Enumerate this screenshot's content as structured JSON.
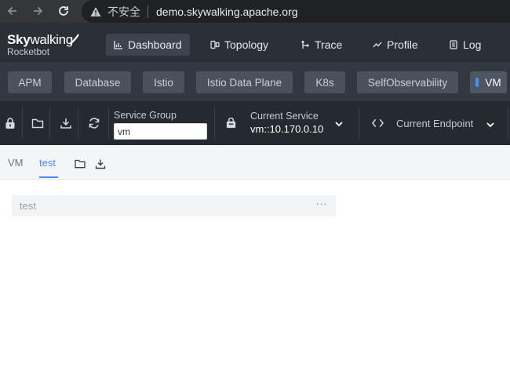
{
  "browser": {
    "insecure_label": "不安全",
    "url": "demo.skywalking.apache.org"
  },
  "logo": {
    "line1_a": "Sky",
    "line1_b": "walking",
    "line2": "Rocketbot"
  },
  "main_nav": [
    {
      "label": "Dashboard",
      "icon": "dashboard-icon",
      "active": true
    },
    {
      "label": "Topology",
      "icon": "topology-icon",
      "active": false
    },
    {
      "label": "Trace",
      "icon": "trace-icon",
      "active": false
    },
    {
      "label": "Profile",
      "icon": "profile-icon",
      "active": false
    },
    {
      "label": "Log",
      "icon": "log-icon",
      "active": false
    }
  ],
  "template_tabs": [
    {
      "label": "APM",
      "active": false
    },
    {
      "label": "Database",
      "active": false
    },
    {
      "label": "Istio",
      "active": false
    },
    {
      "label": "Istio Data Plane",
      "active": false
    },
    {
      "label": "K8s",
      "active": false
    },
    {
      "label": "SelfObservability",
      "active": false
    },
    {
      "label": "VM",
      "active": true
    }
  ],
  "toolbar": {
    "service_group_label": "Service Group",
    "service_group_value": "vm",
    "current_service_label": "Current Service",
    "current_service_value": "vm::10.170.0.10",
    "current_endpoint_label": "Current Endpoint"
  },
  "sub_tabs": [
    {
      "label": "VM",
      "active": false
    },
    {
      "label": "test",
      "active": true
    }
  ],
  "widget": {
    "title": "test",
    "menu": "···"
  },
  "colors": {
    "accent": "#448dfe",
    "header_bg": "#2b3037",
    "tabs_bg": "#333840",
    "toolbar_bg": "#252a30"
  }
}
